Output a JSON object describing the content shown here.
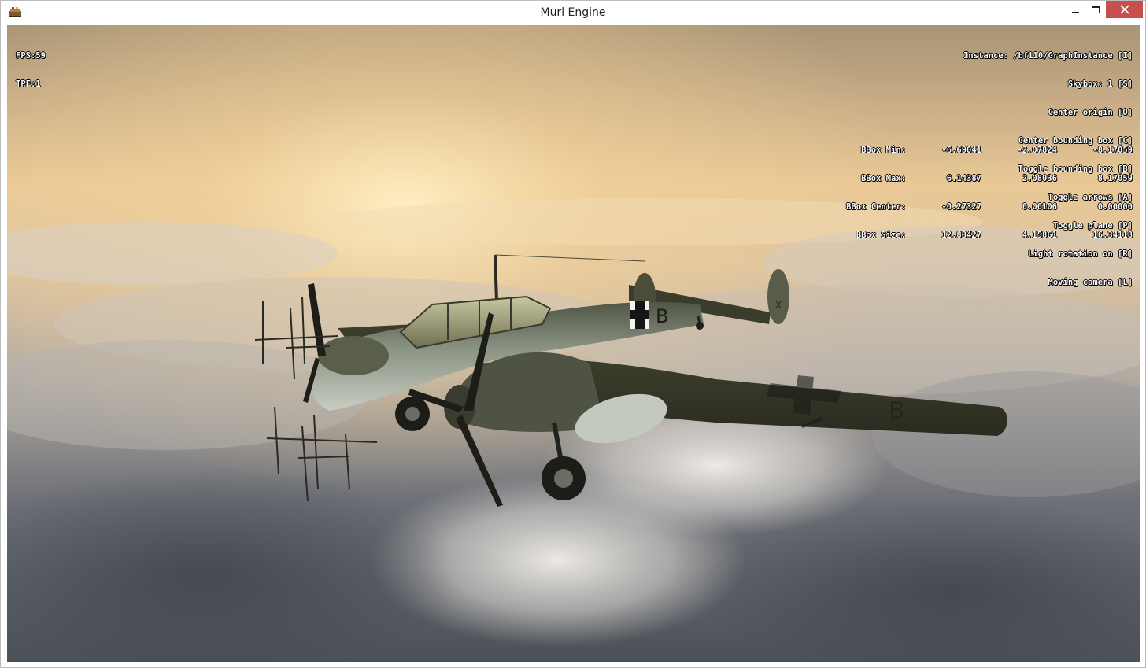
{
  "window": {
    "title": "Murl Engine",
    "colors": {
      "close_button": "#c7504f",
      "titlebar": "#ffffff"
    }
  },
  "hud": {
    "fps": "FPS:59",
    "tpf": "TPF:1",
    "controls": [
      "Instance: /bf110/GraphInstance [I]",
      "Skybox: 1 [S]",
      "Center origin [O]",
      "Center bounding box [C]",
      "Toggle bounding box [B]",
      "Toggle arrows [A]",
      "Toggle plane [P]",
      "Light rotation on [R]",
      "Moving camera [L]"
    ],
    "bbox": [
      {
        "label": "BBox Min:",
        "x": "-6.69041",
        "y": "-2.07824",
        "z": "-8.17059"
      },
      {
        "label": "BBox Max:",
        "x": "6.14387",
        "y": "2.08036",
        "z": "8.17059"
      },
      {
        "label": "BBox Center:",
        "x": "-0.27327",
        "y": "0.00106",
        "z": "0.00000"
      },
      {
        "label": "BBox Size:",
        "x": "12.83427",
        "y": "4.15861",
        "z": "16.34118"
      }
    ]
  },
  "scene": {
    "fuselage_letter": "B",
    "wing_letter": "B",
    "tail_letter": "X",
    "colors": {
      "sky_top": "#b39a79",
      "sky_glow": "#f6d79c",
      "cloud": "#cfc7bb",
      "storm": "#5d6167",
      "aircraft": "#5e6450"
    }
  }
}
